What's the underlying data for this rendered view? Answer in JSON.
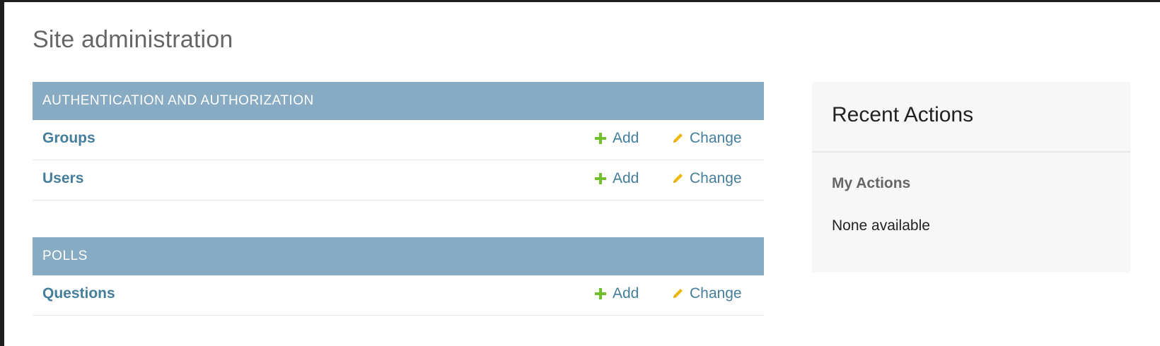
{
  "page": {
    "title": "Site administration"
  },
  "modules": [
    {
      "caption": "AUTHENTICATION AND AUTHORIZATION",
      "models": [
        {
          "name": "Groups",
          "add_label": "Add",
          "change_label": "Change"
        },
        {
          "name": "Users",
          "add_label": "Add",
          "change_label": "Change"
        }
      ]
    },
    {
      "caption": "POLLS",
      "models": [
        {
          "name": "Questions",
          "add_label": "Add",
          "change_label": "Change"
        }
      ]
    }
  ],
  "recent_actions": {
    "title": "Recent Actions",
    "subtitle": "My Actions",
    "empty_text": "None available"
  },
  "icons": {
    "add": "plus-icon",
    "change": "pencil-icon"
  },
  "colors": {
    "module_header": "#87abc3",
    "link": "#447e9b",
    "add_icon": "#70bf2b",
    "change_icon": "#efb80b"
  }
}
